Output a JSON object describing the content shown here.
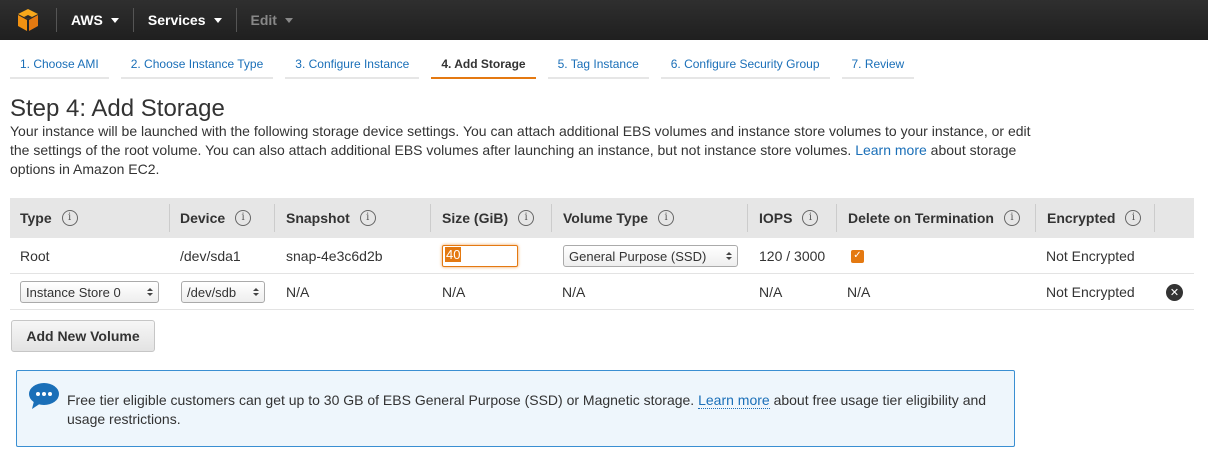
{
  "nav": {
    "aws_label": "AWS",
    "services_label": "Services",
    "edit_label": "Edit"
  },
  "tabs": [
    {
      "label": "1. Choose AMI"
    },
    {
      "label": "2. Choose Instance Type"
    },
    {
      "label": "3. Configure Instance"
    },
    {
      "label": "4. Add Storage",
      "active": true
    },
    {
      "label": "5. Tag Instance"
    },
    {
      "label": "6. Configure Security Group"
    },
    {
      "label": "7. Review"
    }
  ],
  "page": {
    "title": "Step 4: Add Storage",
    "intro_text": "Your instance will be launched with the following storage device settings. You can attach additional EBS volumes and instance store volumes to your instance, or edit the settings of the root volume. You can also attach additional EBS volumes after launching an instance, but not instance store volumes.",
    "intro_link": "Learn more",
    "intro_after": "about storage options in Amazon EC2."
  },
  "table": {
    "headers": {
      "type": "Type",
      "device": "Device",
      "snapshot": "Snapshot",
      "size": "Size (GiB)",
      "volume_type": "Volume Type",
      "iops": "IOPS",
      "delete_on_termination": "Delete on Termination",
      "encrypted": "Encrypted"
    },
    "info_glyph": "i",
    "rows": [
      {
        "type": "Root",
        "device": "/dev/sda1",
        "snapshot": "snap-4e3c6d2b",
        "size": "40",
        "volume_type": "General Purpose (SSD)",
        "iops": "120 / 3000",
        "delete_on_termination": true,
        "encrypted": "Not Encrypted"
      },
      {
        "type": "Instance Store 0",
        "device": "/dev/sdb",
        "snapshot": "N/A",
        "size": "N/A",
        "volume_type": "N/A",
        "iops": "N/A",
        "delete_on_termination": "N/A",
        "encrypted": "Not Encrypted"
      }
    ]
  },
  "add_volume_label": "Add New Volume",
  "notice": {
    "text_before": "Free tier eligible customers can get up to 30 GB of EBS General Purpose (SSD) or Magnetic storage.",
    "link": "Learn more",
    "text_after": "about free usage tier eligibility and usage restrictions."
  },
  "colors": {
    "accent": "#e47911",
    "link": "#1a6fb8",
    "nav_bg": "#2a2a2a",
    "notice_border": "#3a8fd2"
  }
}
